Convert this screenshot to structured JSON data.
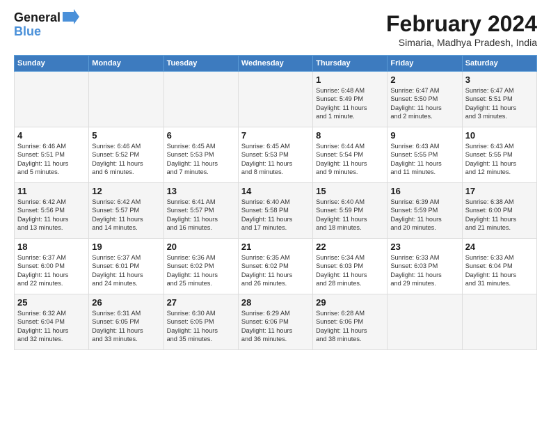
{
  "header": {
    "logo_line1": "General",
    "logo_line2": "Blue",
    "month_title": "February 2024",
    "location": "Simaria, Madhya Pradesh, India"
  },
  "days_of_week": [
    "Sunday",
    "Monday",
    "Tuesday",
    "Wednesday",
    "Thursday",
    "Friday",
    "Saturday"
  ],
  "weeks": [
    [
      {
        "day": "",
        "info": ""
      },
      {
        "day": "",
        "info": ""
      },
      {
        "day": "",
        "info": ""
      },
      {
        "day": "",
        "info": ""
      },
      {
        "day": "1",
        "info": "Sunrise: 6:48 AM\nSunset: 5:49 PM\nDaylight: 11 hours\nand 1 minute."
      },
      {
        "day": "2",
        "info": "Sunrise: 6:47 AM\nSunset: 5:50 PM\nDaylight: 11 hours\nand 2 minutes."
      },
      {
        "day": "3",
        "info": "Sunrise: 6:47 AM\nSunset: 5:51 PM\nDaylight: 11 hours\nand 3 minutes."
      }
    ],
    [
      {
        "day": "4",
        "info": "Sunrise: 6:46 AM\nSunset: 5:51 PM\nDaylight: 11 hours\nand 5 minutes."
      },
      {
        "day": "5",
        "info": "Sunrise: 6:46 AM\nSunset: 5:52 PM\nDaylight: 11 hours\nand 6 minutes."
      },
      {
        "day": "6",
        "info": "Sunrise: 6:45 AM\nSunset: 5:53 PM\nDaylight: 11 hours\nand 7 minutes."
      },
      {
        "day": "7",
        "info": "Sunrise: 6:45 AM\nSunset: 5:53 PM\nDaylight: 11 hours\nand 8 minutes."
      },
      {
        "day": "8",
        "info": "Sunrise: 6:44 AM\nSunset: 5:54 PM\nDaylight: 11 hours\nand 9 minutes."
      },
      {
        "day": "9",
        "info": "Sunrise: 6:43 AM\nSunset: 5:55 PM\nDaylight: 11 hours\nand 11 minutes."
      },
      {
        "day": "10",
        "info": "Sunrise: 6:43 AM\nSunset: 5:55 PM\nDaylight: 11 hours\nand 12 minutes."
      }
    ],
    [
      {
        "day": "11",
        "info": "Sunrise: 6:42 AM\nSunset: 5:56 PM\nDaylight: 11 hours\nand 13 minutes."
      },
      {
        "day": "12",
        "info": "Sunrise: 6:42 AM\nSunset: 5:57 PM\nDaylight: 11 hours\nand 14 minutes."
      },
      {
        "day": "13",
        "info": "Sunrise: 6:41 AM\nSunset: 5:57 PM\nDaylight: 11 hours\nand 16 minutes."
      },
      {
        "day": "14",
        "info": "Sunrise: 6:40 AM\nSunset: 5:58 PM\nDaylight: 11 hours\nand 17 minutes."
      },
      {
        "day": "15",
        "info": "Sunrise: 6:40 AM\nSunset: 5:59 PM\nDaylight: 11 hours\nand 18 minutes."
      },
      {
        "day": "16",
        "info": "Sunrise: 6:39 AM\nSunset: 5:59 PM\nDaylight: 11 hours\nand 20 minutes."
      },
      {
        "day": "17",
        "info": "Sunrise: 6:38 AM\nSunset: 6:00 PM\nDaylight: 11 hours\nand 21 minutes."
      }
    ],
    [
      {
        "day": "18",
        "info": "Sunrise: 6:37 AM\nSunset: 6:00 PM\nDaylight: 11 hours\nand 22 minutes."
      },
      {
        "day": "19",
        "info": "Sunrise: 6:37 AM\nSunset: 6:01 PM\nDaylight: 11 hours\nand 24 minutes."
      },
      {
        "day": "20",
        "info": "Sunrise: 6:36 AM\nSunset: 6:02 PM\nDaylight: 11 hours\nand 25 minutes."
      },
      {
        "day": "21",
        "info": "Sunrise: 6:35 AM\nSunset: 6:02 PM\nDaylight: 11 hours\nand 26 minutes."
      },
      {
        "day": "22",
        "info": "Sunrise: 6:34 AM\nSunset: 6:03 PM\nDaylight: 11 hours\nand 28 minutes."
      },
      {
        "day": "23",
        "info": "Sunrise: 6:33 AM\nSunset: 6:03 PM\nDaylight: 11 hours\nand 29 minutes."
      },
      {
        "day": "24",
        "info": "Sunrise: 6:33 AM\nSunset: 6:04 PM\nDaylight: 11 hours\nand 31 minutes."
      }
    ],
    [
      {
        "day": "25",
        "info": "Sunrise: 6:32 AM\nSunset: 6:04 PM\nDaylight: 11 hours\nand 32 minutes."
      },
      {
        "day": "26",
        "info": "Sunrise: 6:31 AM\nSunset: 6:05 PM\nDaylight: 11 hours\nand 33 minutes."
      },
      {
        "day": "27",
        "info": "Sunrise: 6:30 AM\nSunset: 6:05 PM\nDaylight: 11 hours\nand 35 minutes."
      },
      {
        "day": "28",
        "info": "Sunrise: 6:29 AM\nSunset: 6:06 PM\nDaylight: 11 hours\nand 36 minutes."
      },
      {
        "day": "29",
        "info": "Sunrise: 6:28 AM\nSunset: 6:06 PM\nDaylight: 11 hours\nand 38 minutes."
      },
      {
        "day": "",
        "info": ""
      },
      {
        "day": "",
        "info": ""
      }
    ]
  ]
}
